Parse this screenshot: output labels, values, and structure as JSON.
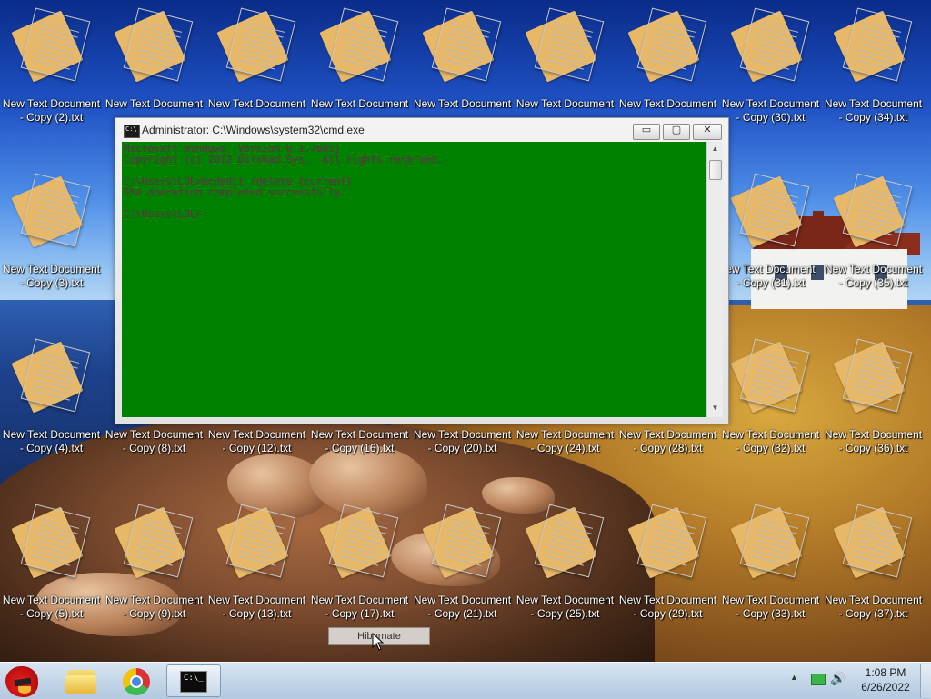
{
  "desktop": {
    "icon_name": "New Text Document",
    "icons": [
      {
        "line1": "New Text Document",
        "line2": "- Copy (2).txt"
      },
      {
        "line1": "New Text Document",
        "line2": ""
      },
      {
        "line1": "New Text Document",
        "line2": ""
      },
      {
        "line1": "New Text Document",
        "line2": ""
      },
      {
        "line1": "New Text Document",
        "line2": ""
      },
      {
        "line1": "New Text Document",
        "line2": ""
      },
      {
        "line1": "New Text Document",
        "line2": ""
      },
      {
        "line1": "New Text Document",
        "line2": "- Copy (30).txt"
      },
      {
        "line1": "New Text Document",
        "line2": "- Copy (34).txt"
      },
      {
        "line1": "New Text Document",
        "line2": "- Copy (3).txt"
      },
      {
        "line1": "ew Text Document",
        "line2": "- Copy (31).txt"
      },
      {
        "line1": "New Text Document",
        "line2": "- Copy (35).txt"
      },
      {
        "line1": "New Text Document",
        "line2": "- Copy (4).txt"
      },
      {
        "line1": "New Text Document",
        "line2": "- Copy (8).txt"
      },
      {
        "line1": "New Text Document",
        "line2": "- Copy (12).txt"
      },
      {
        "line1": "New Text Document",
        "line2": "- Copy (16).txt"
      },
      {
        "line1": "New Text Document",
        "line2": "- Copy (20).txt"
      },
      {
        "line1": "New Text Document",
        "line2": "- Copy (24).txt"
      },
      {
        "line1": "New Text Document",
        "line2": "- Copy (28).txt"
      },
      {
        "line1": "New Text Document",
        "line2": "- Copy (32).txt"
      },
      {
        "line1": "New Text Document",
        "line2": "- Copy (36).txt"
      },
      {
        "line1": "New Text Document",
        "line2": "- Copy (5).txt"
      },
      {
        "line1": "New Text Document",
        "line2": "- Copy (9).txt"
      },
      {
        "line1": "New Text Document",
        "line2": "- Copy (13).txt"
      },
      {
        "line1": "New Text Document",
        "line2": "- Copy (17).txt"
      },
      {
        "line1": "New Text Document",
        "line2": "- Copy (21).txt"
      },
      {
        "line1": "New Text Document",
        "line2": "- Copy (25).txt"
      },
      {
        "line1": "New Text Document",
        "line2": "- Copy (29).txt"
      },
      {
        "line1": "New Text Document",
        "line2": "- Copy (33).txt"
      },
      {
        "line1": "New Text Document",
        "line2": "- Copy (37).txt"
      }
    ]
  },
  "cmd_window": {
    "title": "Administrator: C:\\Windows\\system32\\cmd.exe",
    "minimize_label": "▭",
    "maximize_label": "▢",
    "close_label": "✕",
    "console_bg": "#008000",
    "console_fg": "#7a1f5a",
    "lines": [
      "Microsoft Windows [Version 6.1.7601]",
      "Copyright (c) 2012 Dilshad Sys.  All rights reserved.",
      "",
      "C:\\Users\\LOL>bcdedit /delete {current}",
      "The operation completed successfully.",
      "",
      "C:\\Users\\LOL>"
    ]
  },
  "tooltip": {
    "text": "Hibernate"
  },
  "taskbar": {
    "items": [
      {
        "icon": "angry-birds-icon"
      },
      {
        "icon": "windows-explorer-icon"
      },
      {
        "icon": "chrome-icon"
      },
      {
        "icon": "cmd-icon",
        "label": "C:\\_",
        "active": true
      }
    ],
    "tray": {
      "show_hidden": "▲",
      "volume": "🔊"
    },
    "clock": {
      "time": "1:08 PM",
      "date": "6/26/2022"
    }
  }
}
